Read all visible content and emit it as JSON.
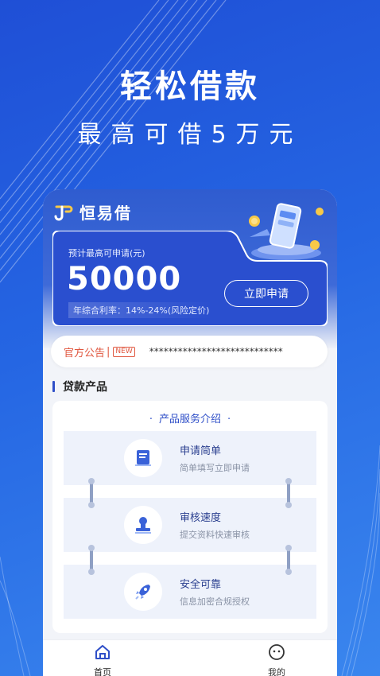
{
  "hero": {
    "title": "轻松借款",
    "subtitle": "最高可借5万元"
  },
  "brand": {
    "name": "恒易借"
  },
  "quota": {
    "label": "预计最高可申请(元)",
    "amount": "50000",
    "rate": "年综合利率：14%-24%(风险定价)",
    "apply_label": "立即申请"
  },
  "notice": {
    "label": "官方公告",
    "separator": "|",
    "badge": "NEW",
    "text": "****************************"
  },
  "section": {
    "title": "贷款产品"
  },
  "card": {
    "title": "产品服务介绍",
    "dot_left": "·",
    "dot_right": "·",
    "features": [
      {
        "title": "申请简单",
        "desc": "简单填写立即申请",
        "icon": "form-icon"
      },
      {
        "title": "审核速度",
        "desc": "提交资料快速审核",
        "icon": "stamp-icon"
      },
      {
        "title": "安全可靠",
        "desc": "信息加密合规授权",
        "icon": "rocket-icon"
      }
    ]
  },
  "tabs": [
    {
      "label": "首页",
      "icon": "home-icon",
      "active": true
    },
    {
      "label": "我的",
      "icon": "profile-icon",
      "active": false
    }
  ],
  "colors": {
    "primary": "#2f4fc8",
    "accent": "#e0573f",
    "background": "#2566e3"
  }
}
